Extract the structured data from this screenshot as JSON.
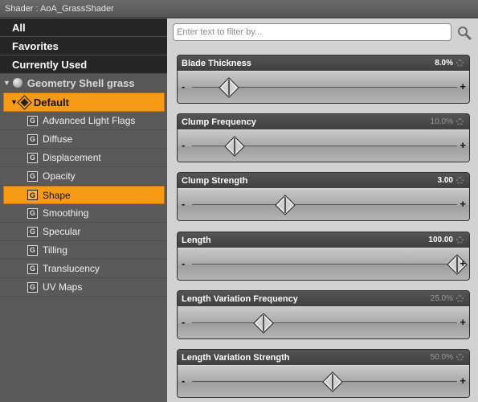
{
  "window": {
    "title": "Shader : AoA_GrassShader"
  },
  "sidebar": {
    "categories": [
      {
        "label": "All"
      },
      {
        "label": "Favorites"
      },
      {
        "label": "Currently Used"
      }
    ],
    "group": {
      "label": "Geometry Shell grass"
    },
    "material": {
      "label": "Default"
    },
    "items": [
      {
        "label": "Advanced Light Flags",
        "icon": "G"
      },
      {
        "label": "Diffuse",
        "icon": "G"
      },
      {
        "label": "Displacement",
        "icon": "G"
      },
      {
        "label": "Opacity",
        "icon": "G"
      },
      {
        "label": "Shape",
        "icon": "G",
        "selected": true
      },
      {
        "label": "Smoothing",
        "icon": "G"
      },
      {
        "label": "Specular",
        "icon": "G"
      },
      {
        "label": "Tilling",
        "icon": "G"
      },
      {
        "label": "Translucency",
        "icon": "G"
      },
      {
        "label": "UV Maps",
        "icon": "G"
      }
    ],
    "selected_color": "#f79a14"
  },
  "filter": {
    "placeholder": "Enter text to filter by...",
    "value": ""
  },
  "sliders": [
    {
      "label": "Blade Thickness",
      "value": "8.0%",
      "position": 0.14,
      "dim": false
    },
    {
      "label": "Clump Frequency",
      "value": "10.0%",
      "position": 0.16,
      "dim": true
    },
    {
      "label": "Clump Strength",
      "value": "3.00",
      "position": 0.35,
      "dim": false
    },
    {
      "label": "Length",
      "value": "100.00",
      "position": 1.0,
      "dim": false
    },
    {
      "label": "Length Variation Frequency",
      "value": "25.0%",
      "position": 0.27,
      "dim": true
    },
    {
      "label": "Length Variation Strength",
      "value": "50.0%",
      "position": 0.53,
      "dim": true
    }
  ],
  "slider_controls": {
    "minus": "-",
    "plus": "+"
  }
}
